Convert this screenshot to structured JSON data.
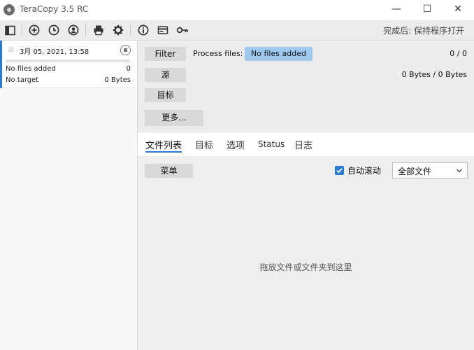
{
  "window": {
    "title": "TeraCopy 3.5 RC",
    "controls": {
      "minimize": "—",
      "maximize": "☐",
      "close": "✕"
    }
  },
  "toolbar": {
    "icons": [
      "panel-toggle-icon",
      "add-icon",
      "history-icon",
      "profile-icon",
      "print-icon",
      "settings-icon",
      "info-icon",
      "card-icon",
      "key-icon"
    ],
    "completion_action": "完成后: 保持程序打开"
  },
  "job": {
    "timestamp": "3月 05, 2021, 13:58",
    "files_label": "No files added",
    "files_count": "0",
    "target_label": "No target",
    "target_size": "0 Bytes",
    "progress": 0
  },
  "main": {
    "filter_label": "Filter",
    "process_label": "Process files:",
    "process_status": "No files added",
    "file_count": "0 / 0",
    "bytes_summary": "0 Bytes / 0 Bytes",
    "source_label": "源",
    "target_label": "目标",
    "more_label": "更多..."
  },
  "tabs": [
    {
      "label": "文件列表",
      "active": true
    },
    {
      "label": "目标",
      "active": false
    },
    {
      "label": "选项",
      "active": false
    },
    {
      "label": "Status",
      "active": false
    },
    {
      "label": "日志",
      "active": false
    }
  ],
  "list": {
    "menu_label": "菜单",
    "autoscroll_label": "自动滚动",
    "autoscroll_checked": true,
    "filter_select": "全部文件",
    "drop_hint": "拖放文件或文件夹到这里"
  },
  "colors": {
    "accent": "#2a7bd3",
    "status_pill": "#9fc8ee"
  }
}
